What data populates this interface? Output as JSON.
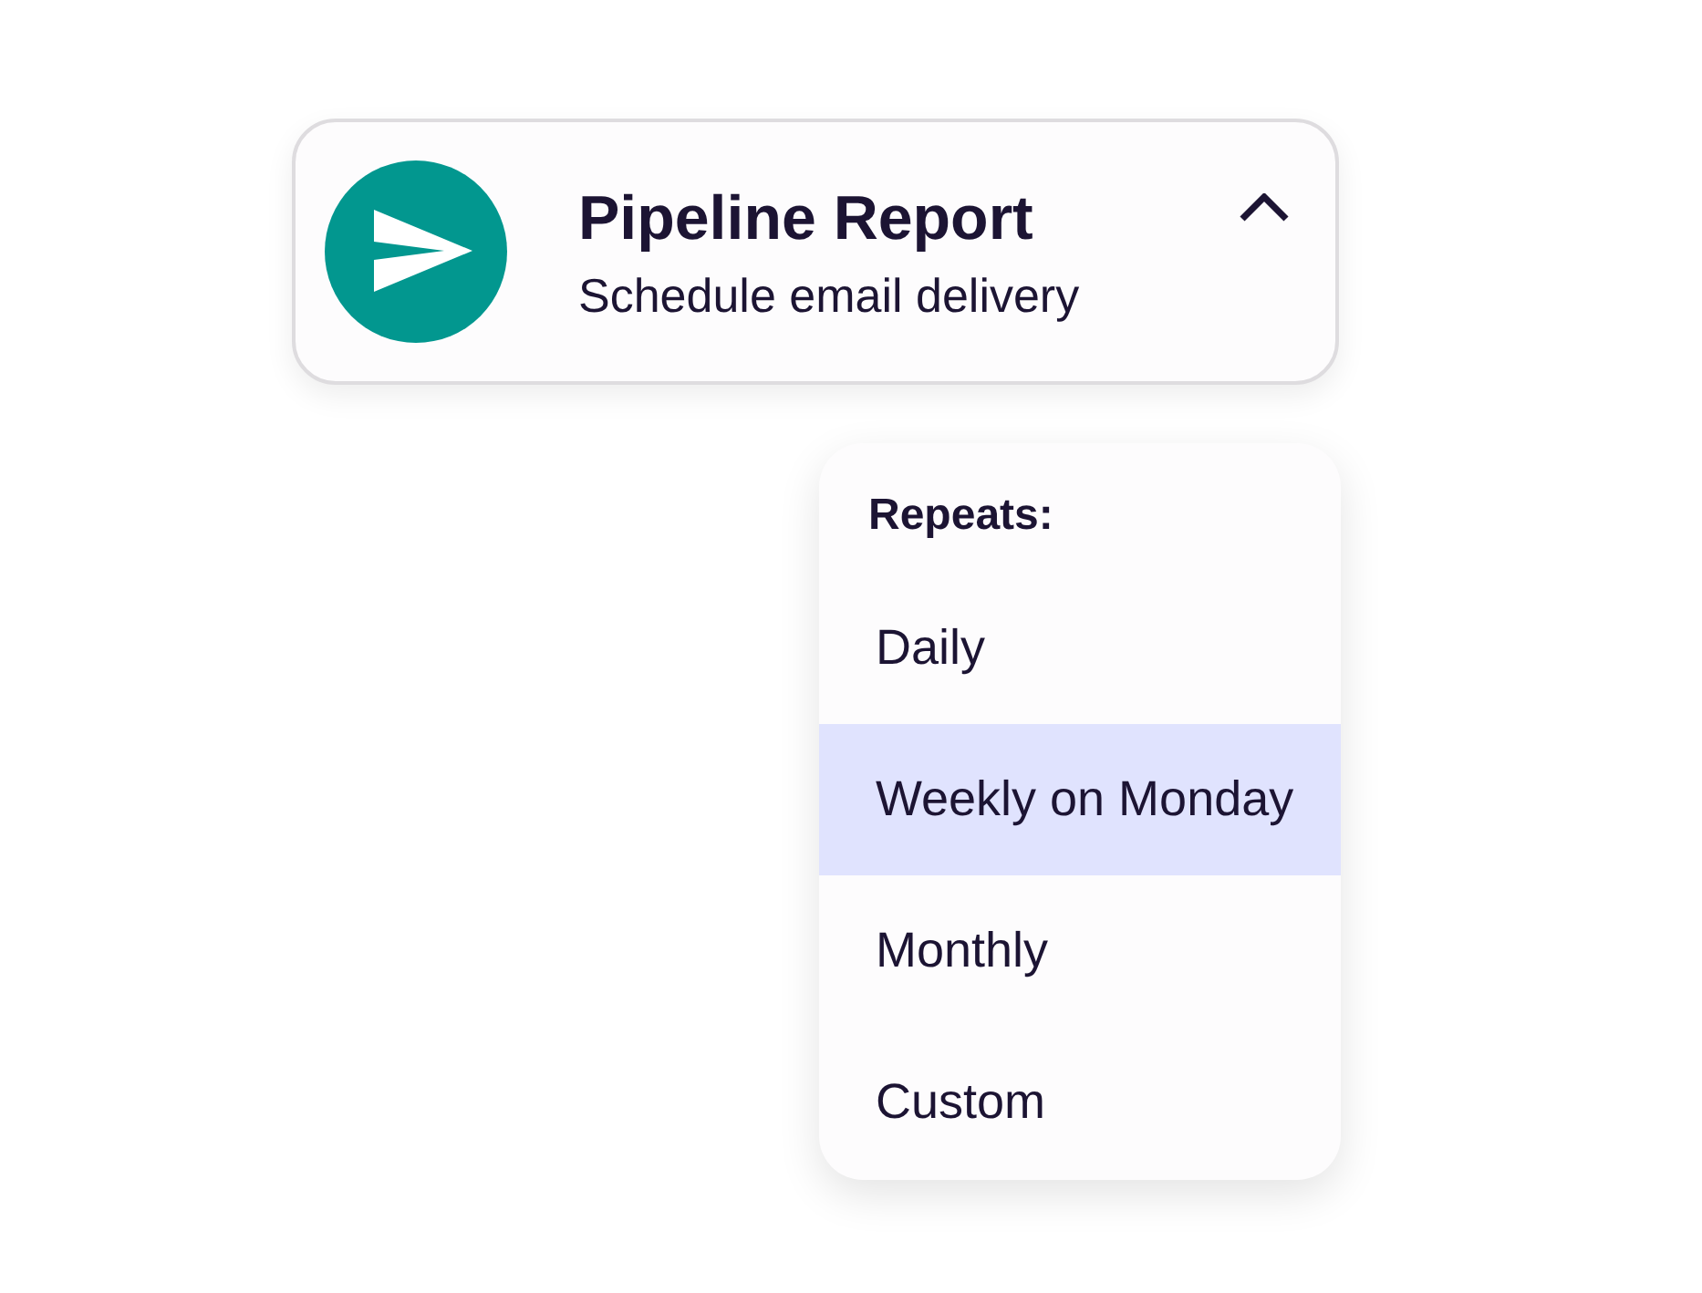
{
  "card": {
    "title": "Pipeline Report",
    "subtitle": "Schedule email delivery",
    "expanded": true
  },
  "menu": {
    "heading": "Repeats:",
    "options": [
      {
        "label": "Daily",
        "selected": false
      },
      {
        "label": "Weekly on Monday",
        "selected": true
      },
      {
        "label": "Monthly",
        "selected": false
      },
      {
        "label": "Custom",
        "selected": false
      }
    ]
  }
}
